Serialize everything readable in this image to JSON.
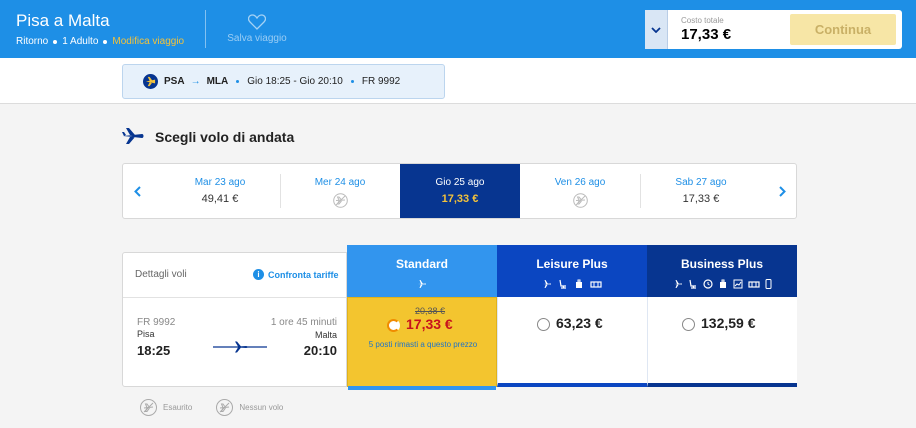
{
  "header": {
    "title": "Pisa a Malta",
    "trip_type": "Ritorno",
    "passengers": "1 Adulto",
    "edit_trip": "Modifica viaggio",
    "save_trip": "Salva viaggio",
    "total_label": "Costo totale",
    "total_value": "17,33 €",
    "continue_label": "Continua"
  },
  "flight_pill": {
    "from": "PSA",
    "to": "MLA",
    "times": "Gio 18:25 - Gio 20:10",
    "flight_number": "FR 9992"
  },
  "section": {
    "title": "Scegli volo di andata"
  },
  "dates": [
    {
      "label": "Mar 23 ago",
      "price": "49,41 €",
      "available": true,
      "selected": false
    },
    {
      "label": "Mer 24 ago",
      "price": "",
      "available": false,
      "selected": false
    },
    {
      "label": "Gio 25 ago",
      "price": "17,33 €",
      "available": true,
      "selected": true
    },
    {
      "label": "Ven 26 ago",
      "price": "",
      "available": false,
      "selected": false
    },
    {
      "label": "Sab 27 ago",
      "price": "17,33 €",
      "available": true,
      "selected": false
    }
  ],
  "details": {
    "header_label": "Dettagli voli",
    "compare_label": "Confronta tariffe",
    "flight_number": "FR 9992",
    "duration": "1 ore 45 minuti",
    "origin": "Pisa",
    "destination": "Malta",
    "departure": "18:25",
    "arrival": "20:10"
  },
  "fares": [
    {
      "name": "Standard",
      "old_price": "20,38 €",
      "price": "17,33 €",
      "note": "5 posti rimasti a questo prezzo",
      "selected": true
    },
    {
      "name": "Leisure Plus",
      "price": "63,23 €"
    },
    {
      "name": "Business Plus",
      "price": "132,59 €"
    }
  ],
  "legend": {
    "sold_out": "Esaurito",
    "no_flight": "Nessun volo"
  },
  "colors": {
    "header_blue": "#1e8fe6",
    "navy": "#073590",
    "yellow": "#f3c52f",
    "price_red": "#c7121d"
  }
}
